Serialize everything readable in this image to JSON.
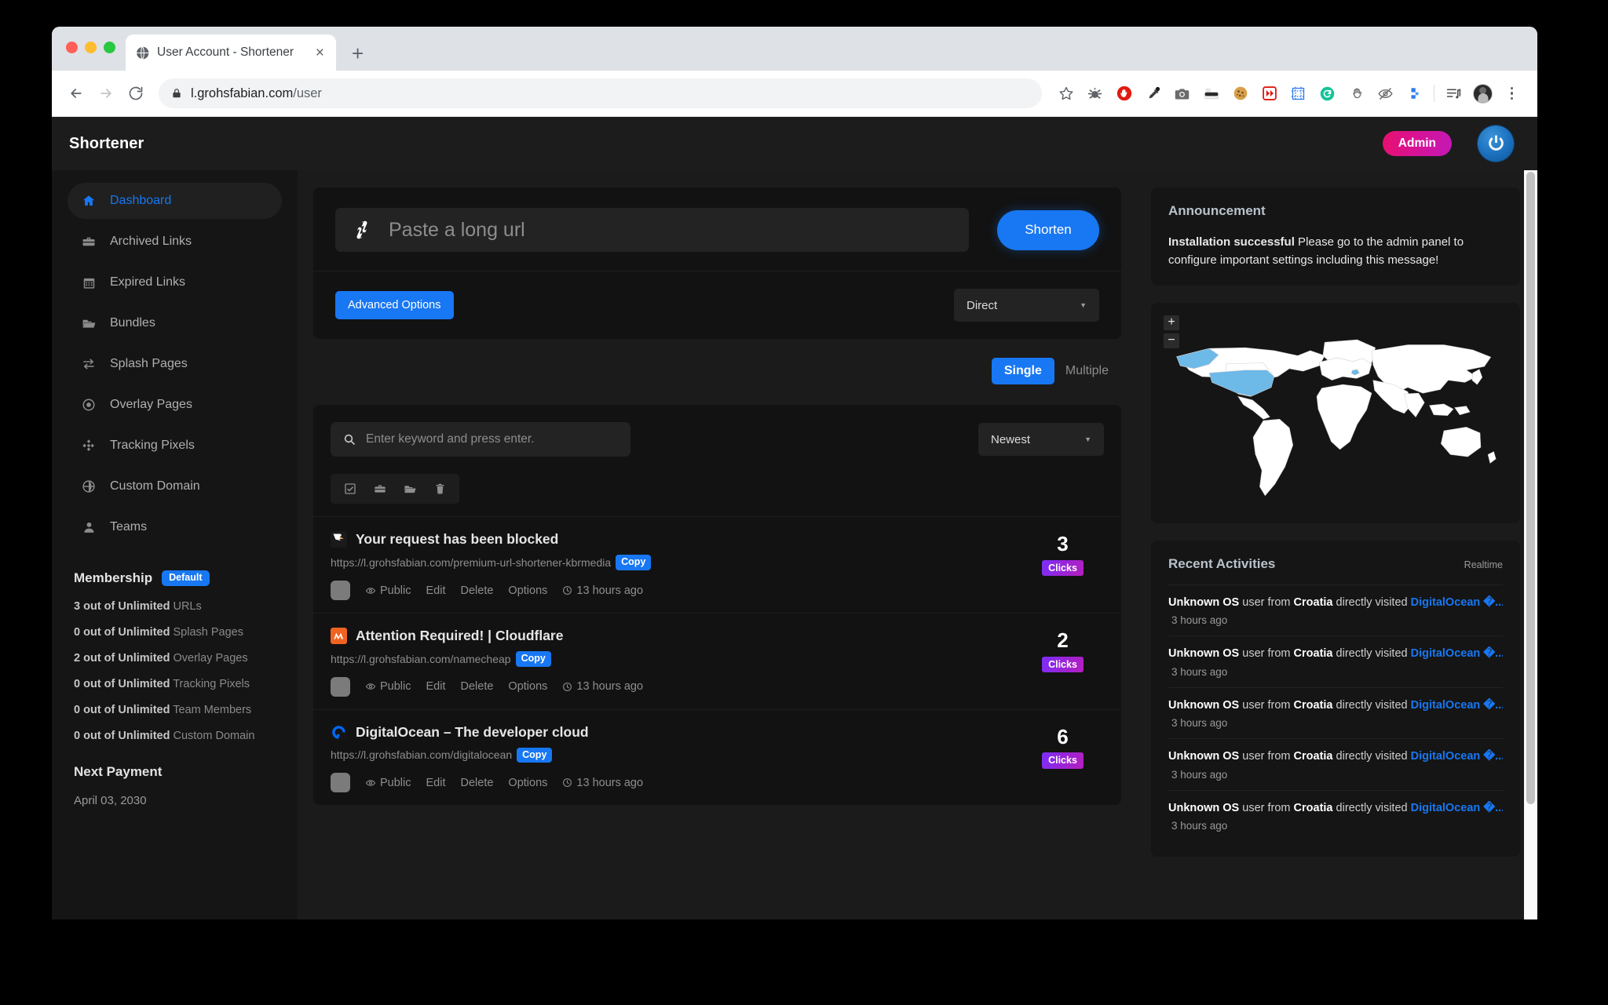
{
  "browser": {
    "tab": {
      "title": "User Account - Shortener",
      "favicon": "globe-icon",
      "close": "×"
    },
    "newtab_label": "+",
    "url": {
      "scheme_host": "l.grohsfabian.com",
      "path": "/user",
      "lock": "lock-icon"
    },
    "extensions": [
      "bookmark-star-icon",
      "bug-gear-icon",
      "adblock-stop-hand-icon",
      "eyedropper-icon",
      "camera-icon",
      "mask-incognito-icon",
      "cookie-icon",
      "video-speed-icon",
      "frame-grid-icon",
      "grammarly-icon",
      "hand-grab-icon",
      "eye-slash-icon",
      "flag-blue-icon"
    ],
    "menu": {
      "list_icon": "reading-list-icon",
      "avatar": "user-avatar",
      "kebab": "more-menu-icon"
    }
  },
  "header": {
    "brand": "Shortener",
    "admin_label": "Admin",
    "power_icon": "power-user-icon"
  },
  "sidebar": {
    "items": [
      {
        "label": "Dashboard",
        "icon": "home-icon",
        "active": true
      },
      {
        "label": "Archived Links",
        "icon": "briefcase-icon",
        "active": false
      },
      {
        "label": "Expired Links",
        "icon": "calendar-icon",
        "active": false
      },
      {
        "label": "Bundles",
        "icon": "folder-icon",
        "active": false
      },
      {
        "label": "Splash Pages",
        "icon": "exchange-icon",
        "active": false
      },
      {
        "label": "Overlay Pages",
        "icon": "target-icon",
        "active": false
      },
      {
        "label": "Tracking Pixels",
        "icon": "crosshair-icon",
        "active": false
      },
      {
        "label": "Custom Domain",
        "icon": "globe-icon",
        "active": false
      },
      {
        "label": "Teams",
        "icon": "person-icon",
        "active": false
      }
    ],
    "membership": {
      "title": "Membership",
      "badge": "Default",
      "rows": [
        {
          "count": "3",
          "mid": "out of Unlimited",
          "label": "URLs"
        },
        {
          "count": "0",
          "mid": "out of Unlimited",
          "label": "Splash Pages"
        },
        {
          "count": "2",
          "mid": "out of Unlimited",
          "label": "Overlay Pages"
        },
        {
          "count": "0",
          "mid": "out of Unlimited",
          "label": "Tracking Pixels"
        },
        {
          "count": "0",
          "mid": "out of Unlimited",
          "label": "Team Members"
        },
        {
          "count": "0",
          "mid": "out of Unlimited",
          "label": "Custom Domain"
        }
      ],
      "next_payment_title": "Next Payment",
      "next_payment_date": "April 03, 2030"
    }
  },
  "shortener": {
    "input_placeholder": "Paste a long url",
    "input_icon": "link-chain-icon",
    "shorten_label": "Shorten",
    "advanced_label": "Advanced Options",
    "type_select": {
      "value": "Direct",
      "caret": "▼"
    },
    "mode": {
      "active": "Single",
      "inactive": "Multiple"
    }
  },
  "links_panel": {
    "search_placeholder": "Enter keyword and press enter.",
    "search_icon": "search-icon",
    "sort_select": {
      "value": "Newest",
      "caret": "▼"
    },
    "bulk_actions": [
      "check-all-icon",
      "archive-briefcase-icon",
      "move-folder-icon",
      "delete-trash-icon"
    ],
    "meta_labels": {
      "visibility": "Public",
      "edit": "Edit",
      "delete": "Delete",
      "options": "Options"
    },
    "copy_label": "Copy",
    "clicks_label": "Clicks",
    "items": [
      {
        "favicon": "eagle-white-icon",
        "title": "Your request has been blocked",
        "url": "https://l.grohsfabian.com/premium-url-shortener-kbrmedia",
        "visibility": "Public",
        "time": "13 hours ago",
        "clicks": "3"
      },
      {
        "favicon": "namecheap-orange-icon",
        "title": "Attention Required! | Cloudflare",
        "url": "https://l.grohsfabian.com/namecheap",
        "visibility": "Public",
        "time": "13 hours ago",
        "clicks": "2"
      },
      {
        "favicon": "digitalocean-blue-icon",
        "title": "DigitalOcean – The developer cloud",
        "url": "https://l.grohsfabian.com/digitalocean",
        "visibility": "Public",
        "time": "13 hours ago",
        "clicks": "6"
      }
    ]
  },
  "announcement": {
    "title": "Announcement",
    "bold": "Installation successful",
    "text": " Please go to the admin panel to configure important settings including this message!"
  },
  "map": {
    "zoom_in": "+",
    "zoom_out": "−",
    "highlight_color": "#6db9e8",
    "land_color": "#ffffff",
    "highlighted_regions": [
      "United States",
      "Alaska",
      "Croatia"
    ]
  },
  "activities": {
    "title": "Recent Activities",
    "realtime_label": "Realtime",
    "items": [
      {
        "os": "Unknown OS",
        "mid1": " user from ",
        "country": "Croatia",
        "mid2": " directly visited ",
        "link": "DigitalOcean �...",
        "time": "3 hours ago"
      },
      {
        "os": "Unknown OS",
        "mid1": " user from ",
        "country": "Croatia",
        "mid2": " directly visited ",
        "link": "DigitalOcean �...",
        "time": "3 hours ago"
      },
      {
        "os": "Unknown OS",
        "mid1": " user from ",
        "country": "Croatia",
        "mid2": " directly visited ",
        "link": "DigitalOcean �...",
        "time": "3 hours ago"
      },
      {
        "os": "Unknown OS",
        "mid1": " user from ",
        "country": "Croatia",
        "mid2": " directly visited ",
        "link": "DigitalOcean �...",
        "time": "3 hours ago"
      },
      {
        "os": "Unknown OS",
        "mid1": " user from ",
        "country": "Croatia",
        "mid2": " directly visited ",
        "link": "DigitalOcean �...",
        "time": "3 hours ago"
      }
    ]
  },
  "colors": {
    "accent_blue": "#1877f2",
    "admin_pink": "#e8106e",
    "clicks_purple": "#7b2ff7",
    "page_bg": "#1b1b1b",
    "panel_bg": "#151515"
  }
}
